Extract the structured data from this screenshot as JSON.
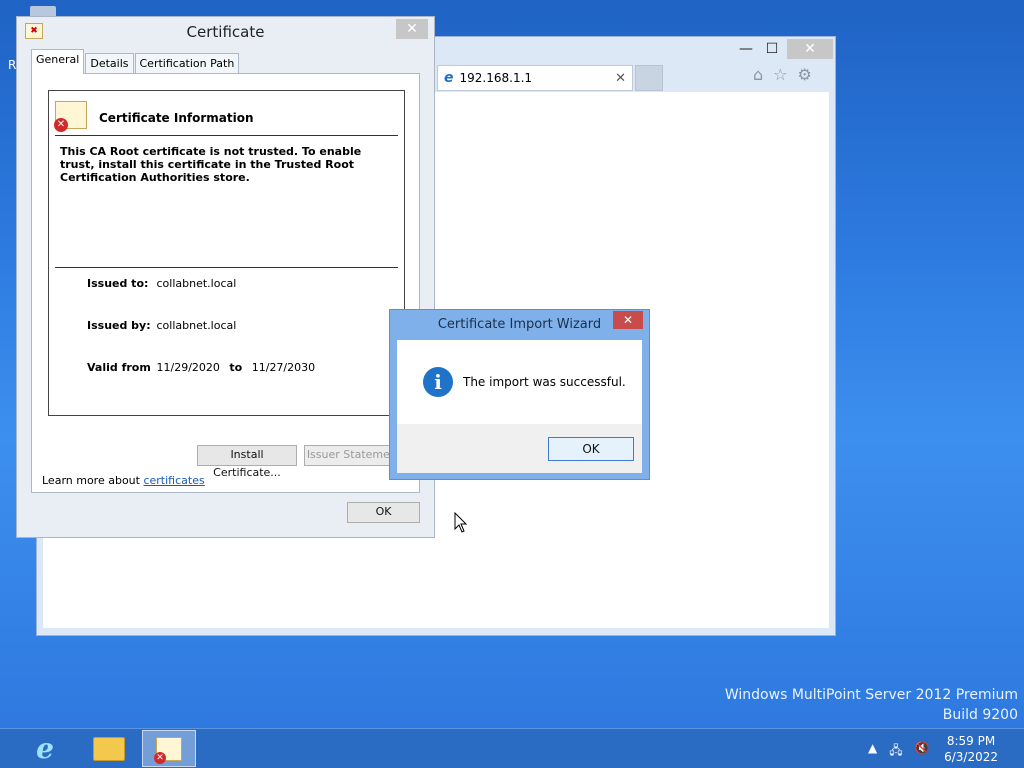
{
  "desktop": {
    "edge_glyph": "R"
  },
  "ie": {
    "controls": {
      "minimize": "—",
      "maximize": "☐",
      "close": "✕"
    },
    "tab": {
      "icon": "e",
      "label": "192.168.1.1",
      "close": "✕"
    },
    "tools": [
      "home-icon",
      "star-icon",
      "gear-icon"
    ]
  },
  "certificate": {
    "title": "Certificate",
    "close": "✕",
    "tabs": [
      {
        "label": "General",
        "active": true
      },
      {
        "label": "Details",
        "active": false
      },
      {
        "label": "Certification Path",
        "active": false
      }
    ],
    "heading": "Certificate Information",
    "warning": "This CA Root certificate is not trusted. To enable trust, install this certificate in the Trusted Root Certification Authorities store.",
    "issued_to_label": "Issued to:",
    "issued_to": "collabnet.local",
    "issued_by_label": "Issued by:",
    "issued_by": "collabnet.local",
    "valid_from_label": "Valid from",
    "valid_from": "11/29/2020",
    "valid_to_label": "to",
    "valid_to": "11/27/2030",
    "install_button": "Install Certificate...",
    "issuer_button": "Issuer Statement",
    "learn_prefix": "Learn more about ",
    "learn_link": "certificates",
    "ok_button": "OK"
  },
  "wizard": {
    "title": "Certificate Import Wizard",
    "close": "✕",
    "message": "The import was successful.",
    "ok_button": "OK"
  },
  "watermark": {
    "line1": "Windows MultiPoint Server 2012 Premium",
    "line2": "Build 9200"
  },
  "taskbar": {
    "tray_arrow": "▲",
    "time": "8:59 PM",
    "date": "6/3/2022"
  }
}
